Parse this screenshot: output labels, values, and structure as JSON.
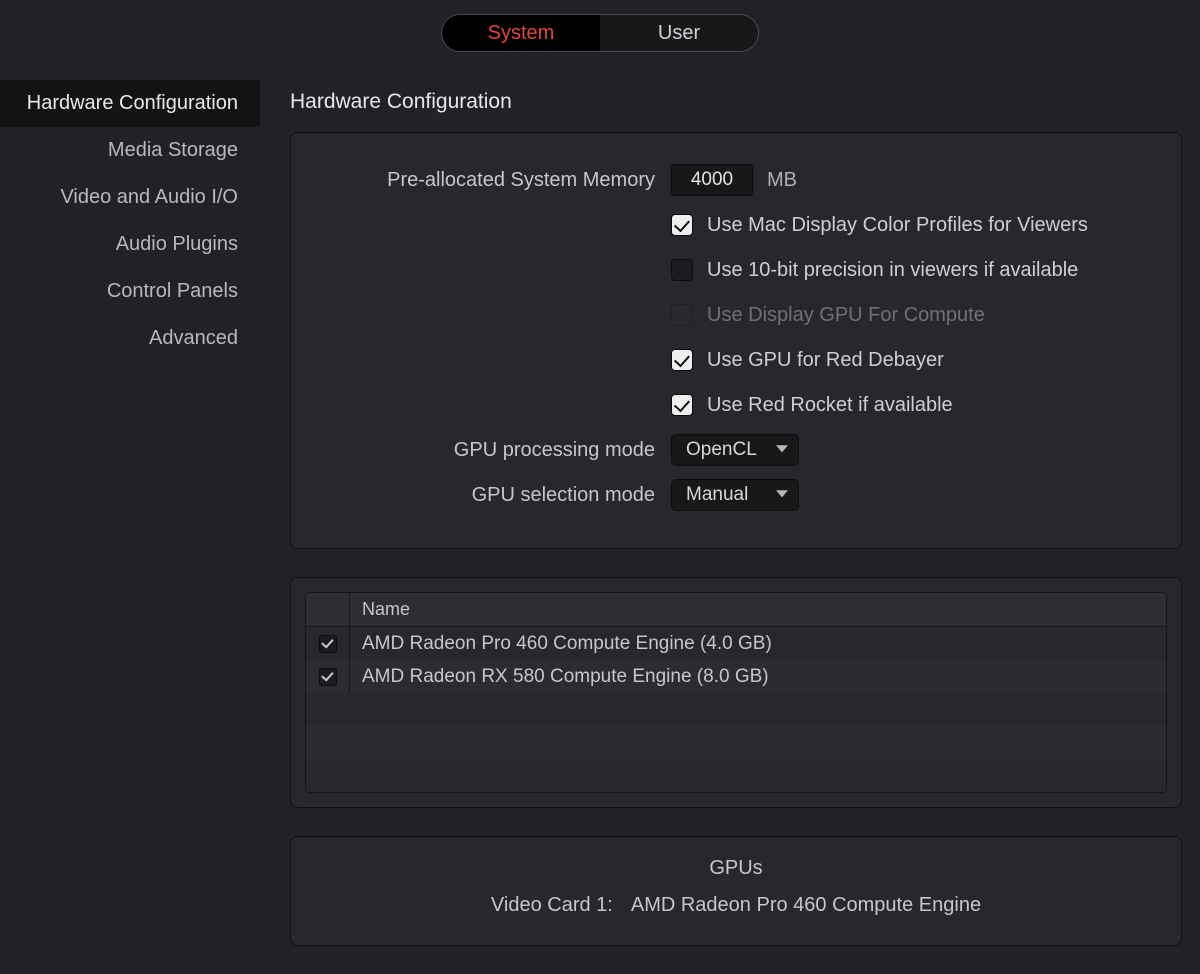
{
  "tabs": {
    "system": "System",
    "user": "User",
    "active": "system"
  },
  "sidebar": {
    "items": [
      {
        "label": "Hardware Configuration",
        "active": true
      },
      {
        "label": "Media Storage"
      },
      {
        "label": "Video and Audio I/O"
      },
      {
        "label": "Audio Plugins"
      },
      {
        "label": "Control Panels"
      },
      {
        "label": "Advanced"
      }
    ]
  },
  "page": {
    "title": "Hardware Configuration"
  },
  "memory": {
    "label": "Pre-allocated System Memory",
    "value": "4000",
    "unit": "MB"
  },
  "options": {
    "mac_profiles": {
      "label": "Use Mac Display Color Profiles for Viewers",
      "checked": true
    },
    "ten_bit": {
      "label": "Use 10-bit precision in viewers if available",
      "checked": false
    },
    "display_gpu": {
      "label": "Use Display GPU For Compute",
      "checked": false,
      "disabled": true
    },
    "red_debayer": {
      "label": "Use GPU for Red Debayer",
      "checked": true
    },
    "red_rocket": {
      "label": "Use Red Rocket if available",
      "checked": true
    }
  },
  "gpu_processing": {
    "label": "GPU processing mode",
    "value": "OpenCL"
  },
  "gpu_selection": {
    "label": "GPU selection mode",
    "value": "Manual"
  },
  "gpu_table": {
    "header": "Name",
    "rows": [
      {
        "checked": true,
        "name": "AMD Radeon Pro 460 Compute Engine (4.0 GB)"
      },
      {
        "checked": true,
        "name": "AMD Radeon RX 580 Compute Engine (8.0 GB)"
      }
    ]
  },
  "gpus_info": {
    "title": "GPUs",
    "card_label": "Video Card 1:",
    "card_value": "AMD Radeon Pro 460 Compute Engine"
  }
}
